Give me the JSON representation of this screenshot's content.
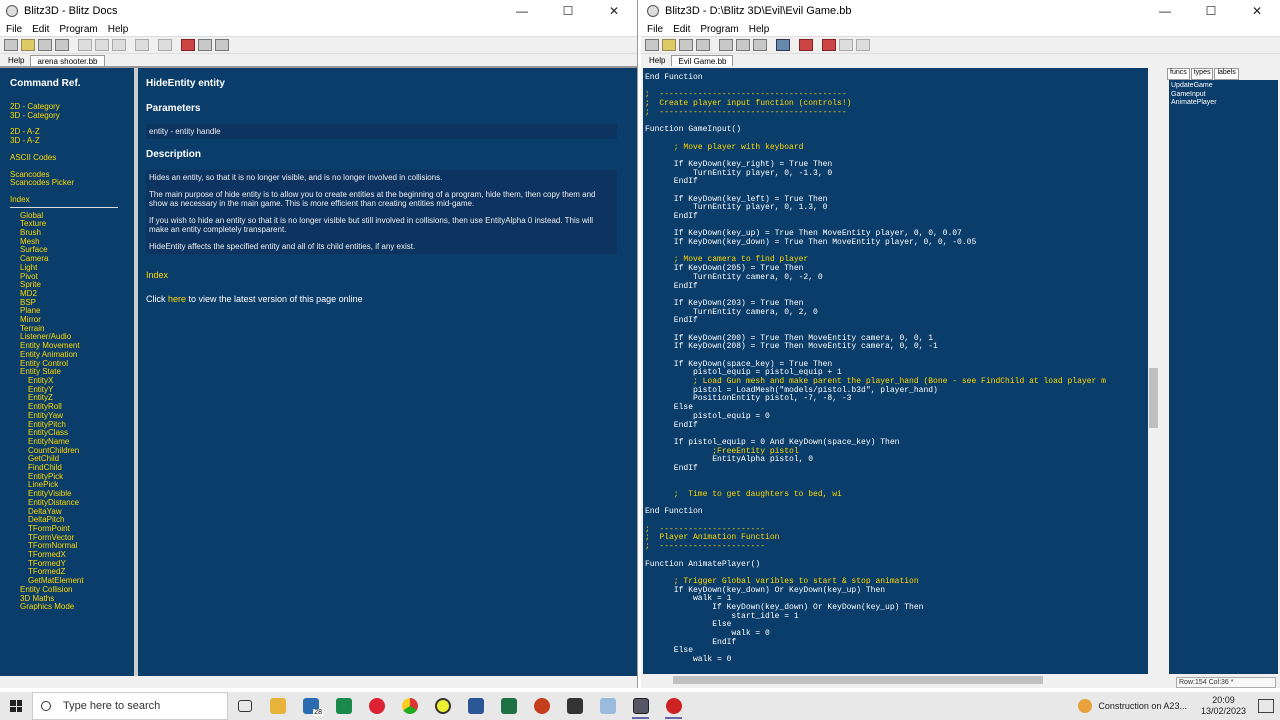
{
  "help_window": {
    "title": "Blitz3D - Blitz Docs",
    "menu": [
      "File",
      "Edit",
      "Program",
      "Help"
    ],
    "tabs": [
      "Help",
      "arena shooter.bb"
    ],
    "nav": {
      "heading": "Command Ref.",
      "groups": [
        [
          "2D - Category",
          "3D - Category"
        ],
        [
          "2D - A-Z",
          "3D - A-Z"
        ],
        [
          "ASCII Codes"
        ],
        [
          "Scancodes",
          "Scancodes Picker"
        ]
      ],
      "index_label": "Index",
      "categories": [
        "Global",
        "Texture",
        "Brush",
        "Mesh",
        "Surface",
        "Camera",
        "Light",
        "Pivot",
        "Sprite",
        "MD2",
        "BSP",
        "Plane",
        "Mirror",
        "Terrain",
        "Listener/Audio",
        "Entity Movement",
        "Entity Animation",
        "Entity Control",
        "Entity State"
      ],
      "entity_state_items": [
        "EntityX",
        "EntityY",
        "EntityZ",
        "EntityRoll",
        "EntityYaw",
        "EntityPitch",
        "EntityClass",
        "EntityName",
        "CountChildren",
        "GetChild",
        "FindChild",
        "EntityPick",
        "LinePick",
        "EntityVisible",
        "EntityDistance",
        "DeltaYaw",
        "DeltaPitch",
        "TFormPoint",
        "TFormVector",
        "TFormNormal",
        "TFormedX",
        "TFormedY",
        "TFormedZ",
        "GetMatElement"
      ],
      "after": [
        "Entity Collision",
        "3D Maths",
        "Graphics Mode"
      ]
    },
    "doc": {
      "title": "HideEntity entity",
      "params_heading": "Parameters",
      "param": "entity - entity handle",
      "desc_heading": "Description",
      "desc": [
        "Hides an entity, so that it is no longer visible, and is no longer involved in collisions.",
        "The main purpose of hide entity is to allow you to create entities at the beginning of a program, hide them, then copy them and show as necessary in the main game. This is more efficient than creating entities mid-game.",
        "If you wish to hide an entity so that it is no longer visible but still involved in collisions, then use EntityAlpha 0 instead. This will make an entity completely transparent.",
        "HideEntity affects the specified entity and all of its child entities, if any exist."
      ],
      "index_link": "Index",
      "click_pre": "Click ",
      "click_link": "here",
      "click_post": " to view the latest version of this page online"
    }
  },
  "editor_window": {
    "title": "Blitz3D - D:\\Blitz 3D\\Evil\\Evil Game.bb",
    "menu": [
      "File",
      "Edit",
      "Program",
      "Help"
    ],
    "tabs": [
      "Help",
      "Evil Game.bb"
    ],
    "code": [
      [
        "End Function",
        "k"
      ],
      [
        "",
        "k"
      ],
      [
        ";  ---------------------------------------",
        "c"
      ],
      [
        ";  Create player input function (controls!)",
        "c"
      ],
      [
        ";  ---------------------------------------",
        "c"
      ],
      [
        "",
        "k"
      ],
      [
        "Function GameInput()",
        "k"
      ],
      [
        "",
        "k"
      ],
      [
        "      ; Move player with keyboard",
        "c"
      ],
      [
        "",
        "k"
      ],
      [
        "      If KeyDown(key_right) = True Then",
        "k"
      ],
      [
        "          TurnEntity player, 0, -1.3, 0",
        "k"
      ],
      [
        "      EndIf",
        "k"
      ],
      [
        "",
        "k"
      ],
      [
        "      If KeyDown(key_left) = True Then",
        "k"
      ],
      [
        "          TurnEntity player, 0, 1.3, 0",
        "k"
      ],
      [
        "      EndIf",
        "k"
      ],
      [
        "",
        "k"
      ],
      [
        "      If KeyDown(key_up) = True Then MoveEntity player, 0, 0, 0.07",
        "k"
      ],
      [
        "      If KeyDown(key_down) = True Then MoveEntity player, 0, 0, -0.05",
        "k"
      ],
      [
        "",
        "k"
      ],
      [
        "      ; Move camera to find player",
        "c"
      ],
      [
        "      If KeyDown(205) = True Then",
        "k"
      ],
      [
        "          TurnEntity camera, 0, -2, 0",
        "k"
      ],
      [
        "      EndIf",
        "k"
      ],
      [
        "",
        "k"
      ],
      [
        "      If KeyDown(203) = True Then",
        "k"
      ],
      [
        "          TurnEntity camera, 0, 2, 0",
        "k"
      ],
      [
        "      EndIf",
        "k"
      ],
      [
        "",
        "k"
      ],
      [
        "      If KeyDown(200) = True Then MoveEntity camera, 0, 0, 1",
        "k"
      ],
      [
        "      If KeyDown(208) = True Then MoveEntity camera, 0, 0, -1",
        "k"
      ],
      [
        "",
        "k"
      ],
      [
        "      If KeyDown(space_key) = True Then",
        "k"
      ],
      [
        "          pistol_equip = pistol_equip + 1",
        "k"
      ],
      [
        "          ; Load Gun mesh and make parent the player_hand (Bone - see FindChild at load player m",
        "c"
      ],
      [
        "          pistol = LoadMesh(\"models/pistol.b3d\", player_hand)",
        "k"
      ],
      [
        "          PositionEntity pistol, -7, -8, -3",
        "k"
      ],
      [
        "      Else",
        "k"
      ],
      [
        "          pistol_equip = 0",
        "k"
      ],
      [
        "      EndIf",
        "k"
      ],
      [
        "",
        "k"
      ],
      [
        "      If pistol_equip = 0 And KeyDown(space_key) Then",
        "k"
      ],
      [
        "              ;FreeEntity pistol",
        "c"
      ],
      [
        "              EntityAlpha pistol, 0",
        "k"
      ],
      [
        "      EndIf",
        "k"
      ],
      [
        "",
        "k"
      ],
      [
        "",
        "k"
      ],
      [
        "      ;  Time to get daughters to bed, wi",
        "c"
      ],
      [
        "",
        "k"
      ],
      [
        "End Function",
        "k"
      ],
      [
        "",
        "k"
      ],
      [
        ";  ----------------------",
        "c"
      ],
      [
        ";  Player Animation Function",
        "c"
      ],
      [
        ";  ----------------------",
        "c"
      ],
      [
        "",
        "k"
      ],
      [
        "Function AnimatePlayer()",
        "k"
      ],
      [
        "",
        "k"
      ],
      [
        "      ; Trigger Global varibles to start & stop animation",
        "c"
      ],
      [
        "      If KeyDown(key_down) Or KeyDown(key_up) Then",
        "k"
      ],
      [
        "          walk = 1",
        "k"
      ],
      [
        "              If KeyDown(key_down) Or KeyDown(key_up) Then",
        "k"
      ],
      [
        "                  start_idle = 1",
        "k"
      ],
      [
        "              Else",
        "k"
      ],
      [
        "                  walk = 0",
        "k"
      ],
      [
        "              EndIf",
        "k"
      ],
      [
        "      Else",
        "k"
      ],
      [
        "          walk = 0",
        "k"
      ]
    ],
    "side_tabs": [
      "funcs",
      "types",
      "labels"
    ],
    "funcs": [
      "UpdateGame",
      "GameInput",
      "AnimatePlayer"
    ],
    "status": "Row:154 Col:36 *"
  },
  "taskbar": {
    "search_placeholder": "Type here to search",
    "mail_badge": "28",
    "weather": "Construction on A23...",
    "time": "20:09",
    "date": "13/02/2023"
  },
  "colors": {
    "pane_bg": "#0a3d6a",
    "comment": "#ffd900",
    "link": "#ffd900"
  }
}
